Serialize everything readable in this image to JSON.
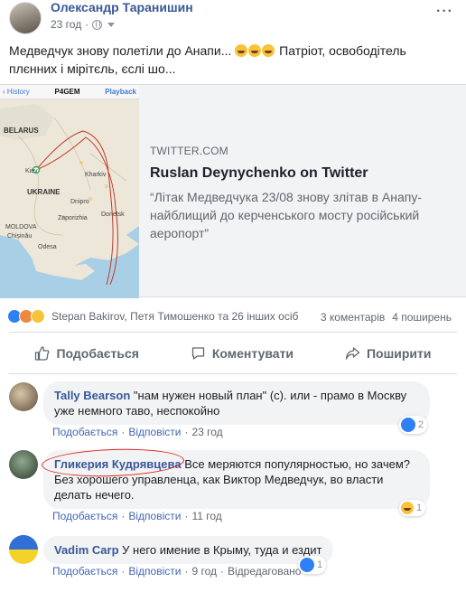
{
  "post": {
    "author": "Олександр Таранишин",
    "time": "23 год",
    "text": "Медведчук знову полетіли до Анапи... 🤣🤣🤣 Патріот, освободітель плєнних і мірітєль, єслі шо...",
    "text_before": "Медведчук знову полетіли до Анапи...",
    "text_after": "Патріот, освободітель плєнних і мірітєль, єслі шо...",
    "more_icon": "more-dots-icon"
  },
  "link_card": {
    "map": {
      "history_label": "History",
      "tag": "P4GEM",
      "playback_label": "Playback",
      "labels": {
        "belarus": "BELARUS",
        "ukraine": "UKRAINE",
        "kiev": "Kiev",
        "moldova": "MOLDOVA",
        "chisinau": "Chișinău",
        "odesa": "Odesa",
        "kharkiv": "Kharkiv",
        "dnipro": "Dnipro",
        "zaporizhia": "Zaporizhia",
        "donetsk": "Donetsk"
      }
    },
    "domain": "TWITTER.COM",
    "title": "Ruslan Deynychenko on Twitter",
    "description": "“Літак Медведчука 23/08 знову злітав в Анапу- найблищий до керченського мосту російський аеропорт”"
  },
  "reactions": {
    "names": "Stepan Bakirov, Петя Тимошенко та 26 інших осіб",
    "comments_count": "3 коментарів",
    "shares_count": "4 поширень",
    "icons": [
      "like-icon",
      "angry-icon",
      "wow-icon"
    ]
  },
  "actions": {
    "like": "Подобається",
    "comment": "Коментувати",
    "share": "Поширити"
  },
  "comments": [
    {
      "name": "Tally Bearson",
      "text": "\"нам нужен новый план\" (с). или - прамо в Москву уже немного таво, неспокойно",
      "like": "Подобається",
      "reply": "Відповісти",
      "time": "23 год",
      "reaction_count": "2"
    },
    {
      "name": "Гликерия Кудрявцева",
      "text": "Все меряются популярностью, но зачем? Без хорошего управленца, как Виктор Медведчук, во власти делать нечего.",
      "like": "Подобається",
      "reply": "Відповісти",
      "time": "11 год",
      "reaction_count": "1"
    },
    {
      "name": "Vadim Carp",
      "text": "У него имение в Крыму, туда и ездит",
      "like": "Подобається",
      "reply": "Відповісти",
      "time": "9 год",
      "edited": "Відредаговано",
      "reaction_count": "1"
    }
  ],
  "colors": {
    "link_blue": "#385898",
    "muted": "#606770",
    "bubble": "#f2f3f5",
    "like_blue": "#2e81f4",
    "annotation_red": "#e02020"
  }
}
